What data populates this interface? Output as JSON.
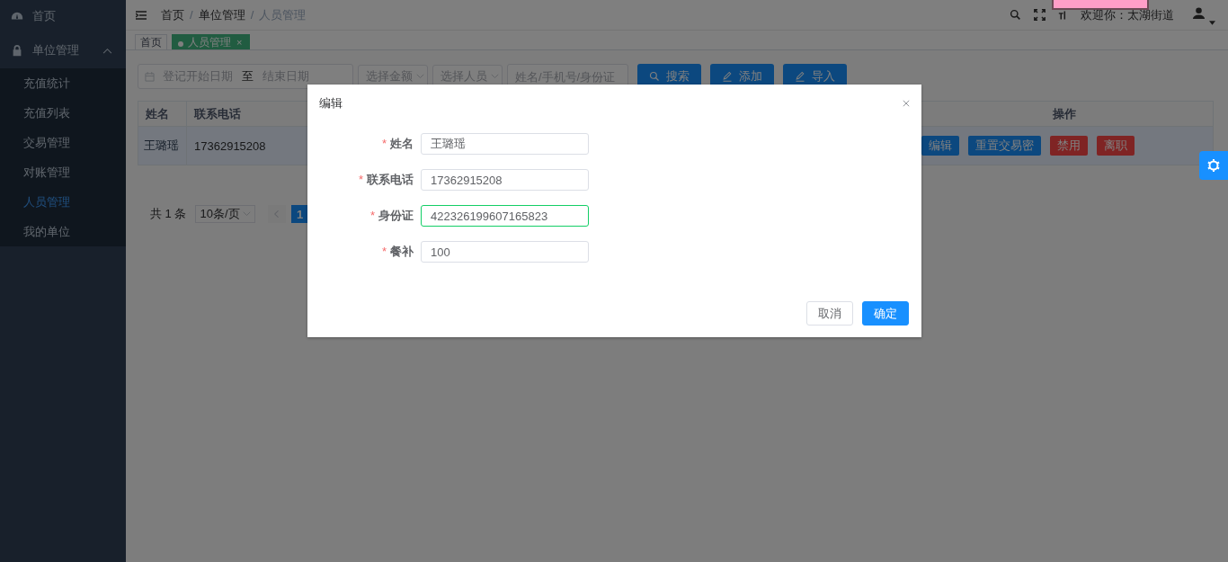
{
  "sidebar": {
    "items": [
      {
        "label": "首页",
        "kind": "link"
      },
      {
        "label": "单位管理",
        "kind": "group",
        "expanded": true,
        "children": [
          {
            "label": "充值统计",
            "selected": false
          },
          {
            "label": "充值列表",
            "selected": false
          },
          {
            "label": "交易管理",
            "selected": false
          },
          {
            "label": "对账管理",
            "selected": false
          },
          {
            "label": "人员管理",
            "selected": true
          },
          {
            "label": "我的单位",
            "selected": false
          }
        ]
      }
    ]
  },
  "header": {
    "breadcrumb": [
      "首页",
      "单位管理",
      "人员管理"
    ],
    "breadcrumb_separator": "/",
    "welcome": "欢迎你：太湖街道"
  },
  "tags": [
    {
      "label": "首页",
      "selected": false
    },
    {
      "label": "人员管理",
      "selected": true,
      "close": "×"
    }
  ],
  "filters": {
    "date_start_placeholder": "登记开始日期",
    "date_separator": "至",
    "date_end_placeholder": "结束日期",
    "selects": [
      "选择金额",
      "选择人员"
    ],
    "search_placeholder": "姓名/手机号/身份证"
  },
  "toolbar_buttons": [
    {
      "label": "搜索",
      "kind": "search"
    },
    {
      "label": "添加",
      "kind": "edit"
    },
    {
      "label": "导入",
      "kind": "edit"
    }
  ],
  "table": {
    "columns": [
      "姓名",
      "联系电话",
      "操作"
    ],
    "rows": [
      {
        "name": "王璐瑶",
        "phone": "17362915208",
        "selected": true,
        "actions": [
          {
            "label": "编辑",
            "kind": "primary"
          },
          {
            "label": "重置交易密",
            "kind": "primary"
          },
          {
            "label": "禁用",
            "kind": "danger"
          },
          {
            "label": "离职",
            "kind": "danger"
          }
        ]
      }
    ]
  },
  "pagination": {
    "total": "共 1 条",
    "page_size": "10条/页",
    "pages": [
      {
        "label": "1",
        "selected": true
      }
    ]
  },
  "dialog": {
    "title": "编辑",
    "fields": [
      {
        "label": "姓名",
        "value": "王璐瑶",
        "required_mark": "*",
        "valid": false
      },
      {
        "label": "联系电话",
        "value": "17362915208",
        "required_mark": "*",
        "valid": false
      },
      {
        "label": "身份证",
        "value": "422326199607165823",
        "required_mark": "*",
        "valid": true
      },
      {
        "label": "餐补",
        "value": "100",
        "required_mark": "*",
        "valid": false
      }
    ],
    "buttons": [
      {
        "label": "取消",
        "kind": "default"
      },
      {
        "label": "确定",
        "kind": "primary"
      }
    ]
  }
}
